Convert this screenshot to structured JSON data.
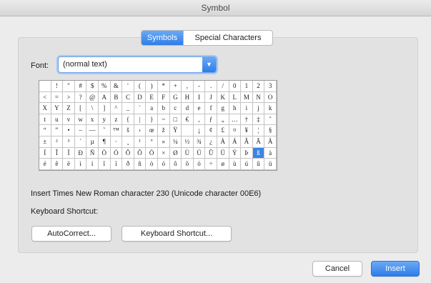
{
  "window": {
    "title": "Symbol"
  },
  "tabs": [
    {
      "label": "Symbols",
      "selected": true
    },
    {
      "label": "Special Characters",
      "selected": false
    }
  ],
  "font": {
    "label": "Font:",
    "value": "(normal text)"
  },
  "grid": {
    "rows": [
      [
        " ",
        "!",
        "\"",
        "#",
        "$",
        "%",
        "&",
        "'",
        "(",
        ")",
        "*",
        "+",
        ",",
        "-",
        ".",
        "/",
        "0",
        "1",
        "2",
        "3"
      ],
      [
        "<",
        "=",
        ">",
        "?",
        "@",
        "A",
        "B",
        "C",
        "D",
        "E",
        "F",
        "G",
        "H",
        "I",
        "J",
        "K",
        "L",
        "M",
        "N",
        "O"
      ],
      [
        "X",
        "Y",
        "Z",
        "[",
        "\\",
        "]",
        "^",
        "_",
        "`",
        "a",
        "b",
        "c",
        "d",
        "e",
        "f",
        "g",
        "h",
        "i",
        "j",
        "k"
      ],
      [
        "t",
        "u",
        "v",
        "w",
        "x",
        "y",
        "z",
        "{",
        "|",
        "}",
        "~",
        "□",
        "€",
        ",",
        "ƒ",
        "„",
        "…",
        "†",
        "‡",
        "ˆ"
      ],
      [
        "“",
        "”",
        "•",
        "–",
        "—",
        "˜",
        "™",
        "š",
        "›",
        "œ",
        "ž",
        "Ÿ",
        " ",
        "¡",
        "¢",
        "£",
        "¤",
        "¥",
        "¦",
        "§"
      ],
      [
        "±",
        "²",
        "³",
        "´",
        "µ",
        "¶",
        "·",
        "¸",
        "¹",
        "º",
        "»",
        "¼",
        "½",
        "¾",
        "¿",
        "À",
        "Á",
        "Â",
        "Ã",
        "Ä"
      ],
      [
        "Í",
        "Î",
        "Ï",
        "Ð",
        "Ñ",
        "Ò",
        "Ó",
        "Ô",
        "Õ",
        "Ö",
        "×",
        "Ø",
        "Ù",
        "Ú",
        "Û",
        "Ü",
        "Ý",
        "Þ",
        "ß",
        "à"
      ],
      [
        "é",
        "ê",
        "ë",
        "ì",
        "í",
        "î",
        "ï",
        "ð",
        "ñ",
        "ò",
        "ó",
        "ô",
        "õ",
        "ö",
        "÷",
        "ø",
        "ù",
        "ú",
        "û",
        "ü"
      ]
    ],
    "selected": {
      "row": 6,
      "col": 18
    }
  },
  "info": "Insert Times New Roman character 230  (Unicode character 00E6)",
  "shortcut_label": "Keyboard Shortcut:",
  "buttons": {
    "autocorrect": "AutoCorrect...",
    "keyboard_shortcut": "Keyboard Shortcut...",
    "cancel": "Cancel",
    "insert": "Insert"
  },
  "colors": {
    "accent": "#2f7de8",
    "background": "#ececec"
  }
}
